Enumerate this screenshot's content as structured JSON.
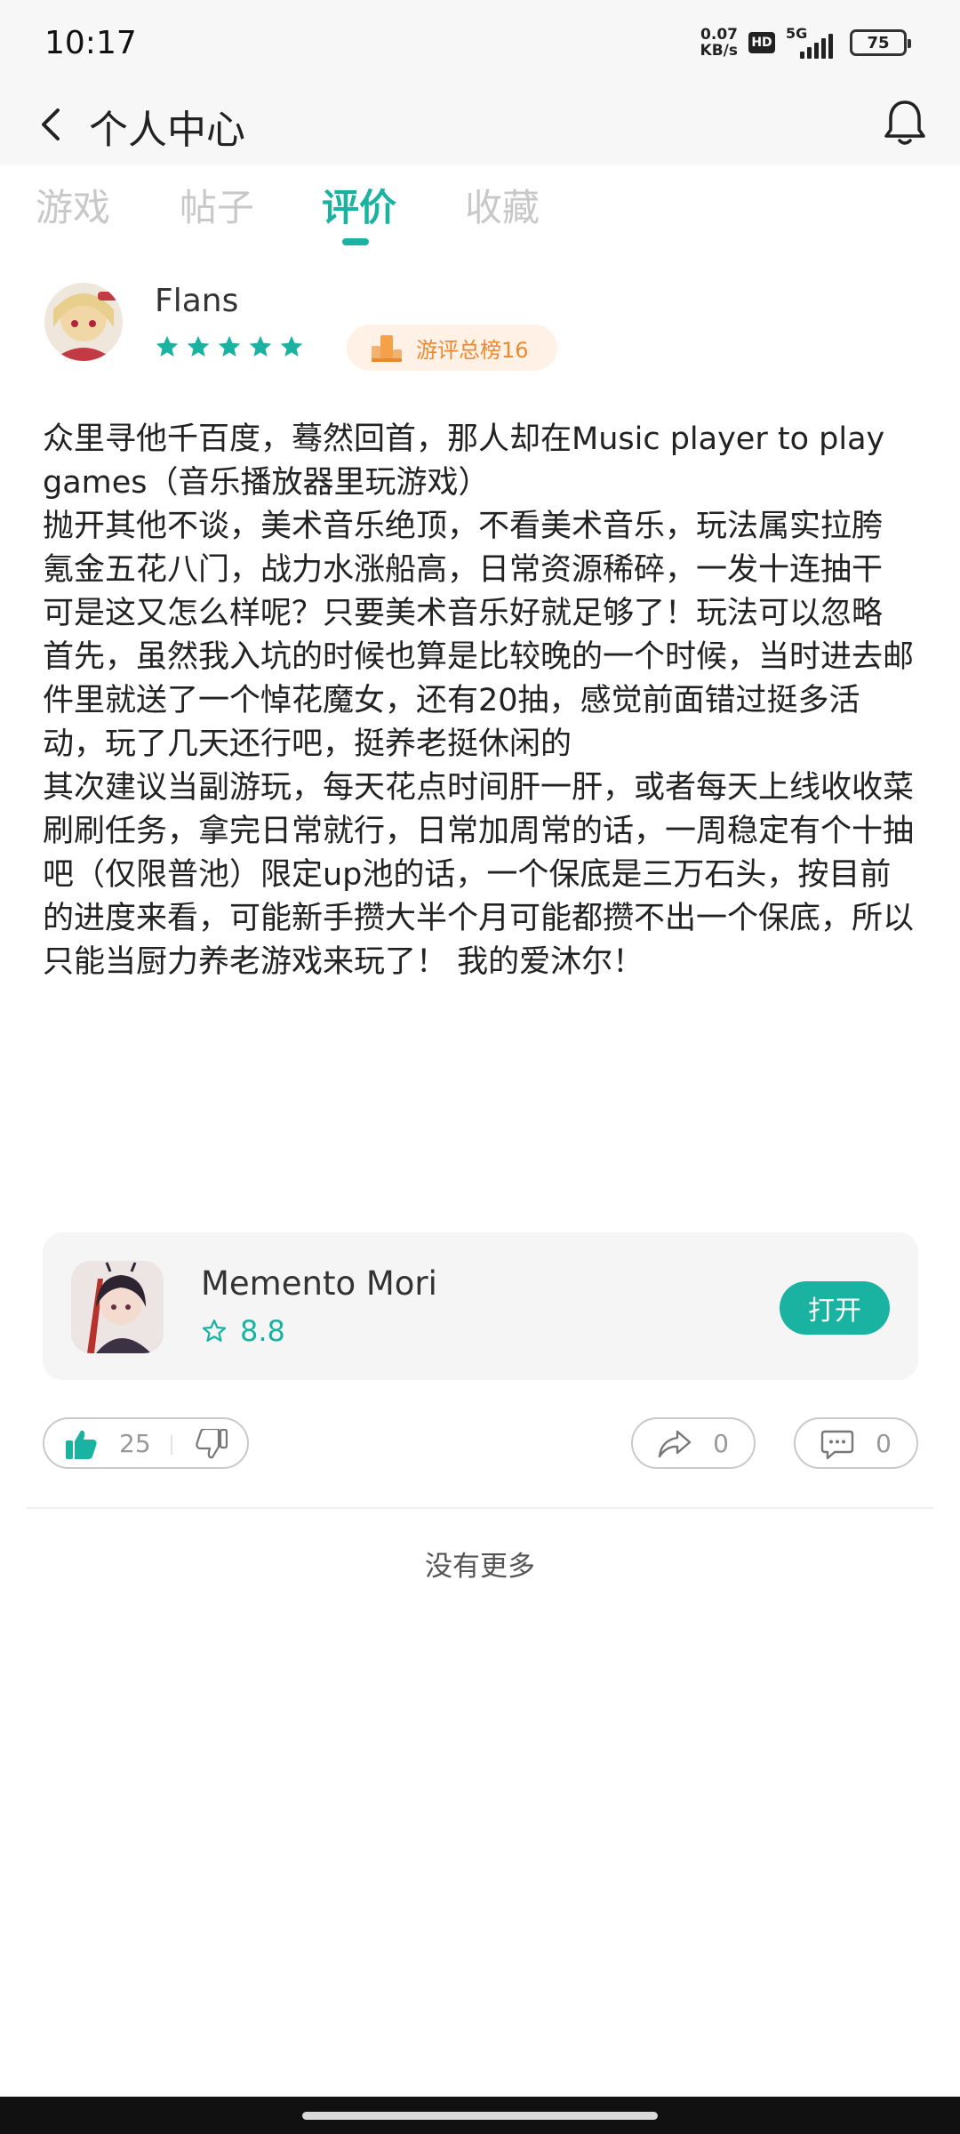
{
  "status_bar": {
    "time": "10:17",
    "net_speed": "0.07",
    "net_unit": "KB/s",
    "hd_label": "HD",
    "network_label": "5G",
    "battery": "75"
  },
  "header": {
    "title": "个人中心",
    "back_icon": "chevron-left-icon",
    "bell_icon": "bell-icon"
  },
  "tabs": [
    {
      "label": "游戏",
      "active": false
    },
    {
      "label": "帖子",
      "active": false
    },
    {
      "label": "评价",
      "active": true
    },
    {
      "label": "收藏",
      "active": false
    }
  ],
  "review": {
    "user_name": "Flans",
    "stars": 5,
    "badge_text": "游评总榜16",
    "paragraphs": [
      "众里寻他千百度，蓦然回首，那人却在Music player to play games（音乐播放器里玩游戏）",
      "抛开其他不谈，美术音乐绝顶，不看美术音乐，玩法属实拉胯",
      "氪金五花八门，战力水涨船高，日常资源稀碎，一发十连抽干",
      "可是这又怎么样呢？只要美术音乐好就足够了！玩法可以忽略",
      "首先，虽然我入坑的时候也算是比较晚的一个时候，当时进去邮件里就送了一个悼花魔女，还有20抽，感觉前面错过挺多活动，玩了几天还行吧，挺养老挺休闲的",
      "其次建议当副游玩，每天花点时间肝一肝，或者每天上线收收菜刷刷任务，拿完日常就行，日常加周常的话，一周稳定有个十抽吧（仅限普池）限定up池的话，一个保底是三万石头，按目前的进度来看，可能新手攒大半个月可能都攒不出一个保底，所以只能当厨力养老游戏来玩了！ 我的爱沐尔！"
    ]
  },
  "game": {
    "name": "Memento Mori",
    "rating": "8.8",
    "open_label": "打开"
  },
  "actions": {
    "likes": "25",
    "shares": "0",
    "comments": "0"
  },
  "footer_text": "没有更多",
  "colors": {
    "accent": "#1ab3a2",
    "badge_bg": "#fff1e5",
    "badge_text": "#ea8a33"
  }
}
